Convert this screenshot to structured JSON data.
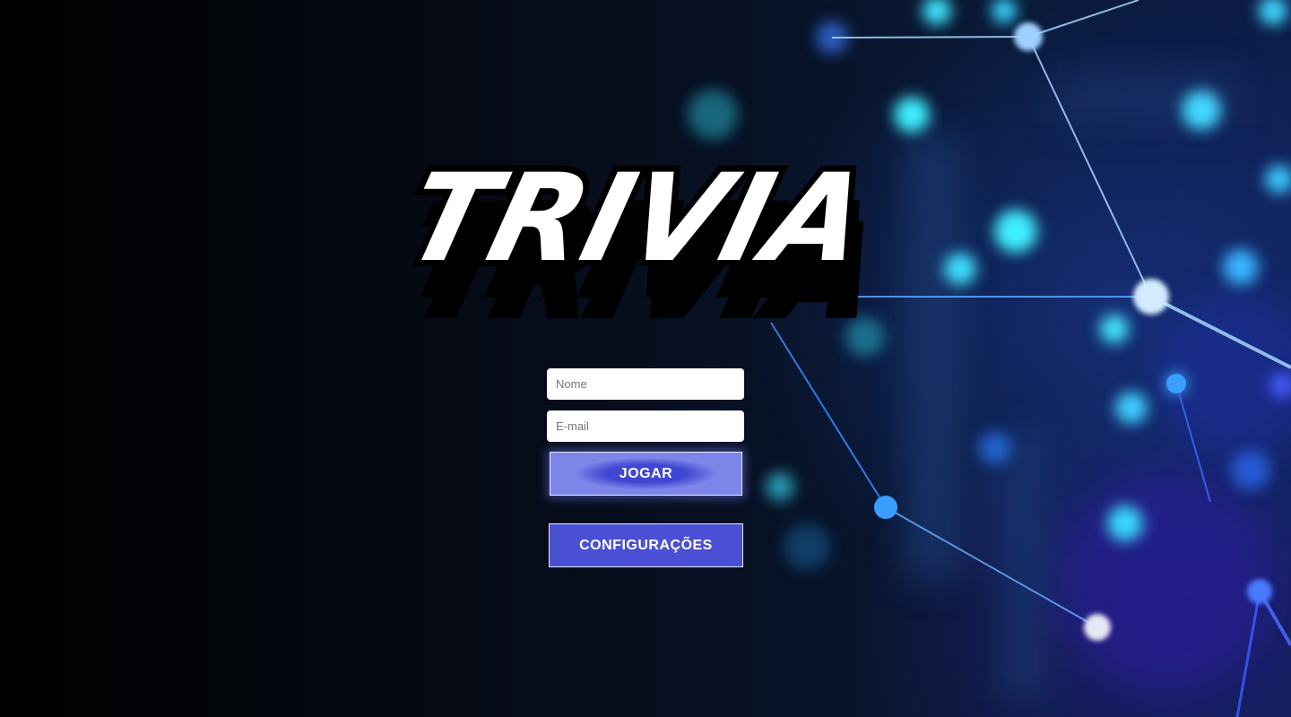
{
  "logo": {
    "text": "TRIVIA"
  },
  "form": {
    "name_placeholder": "Nome",
    "email_placeholder": "E-mail",
    "play_label": "JOGAR",
    "settings_label": "CONFIGURAÇÕES"
  },
  "colors": {
    "background": "#02050c",
    "button": "#4a50d4",
    "network_glow": "#3fd3ff"
  }
}
